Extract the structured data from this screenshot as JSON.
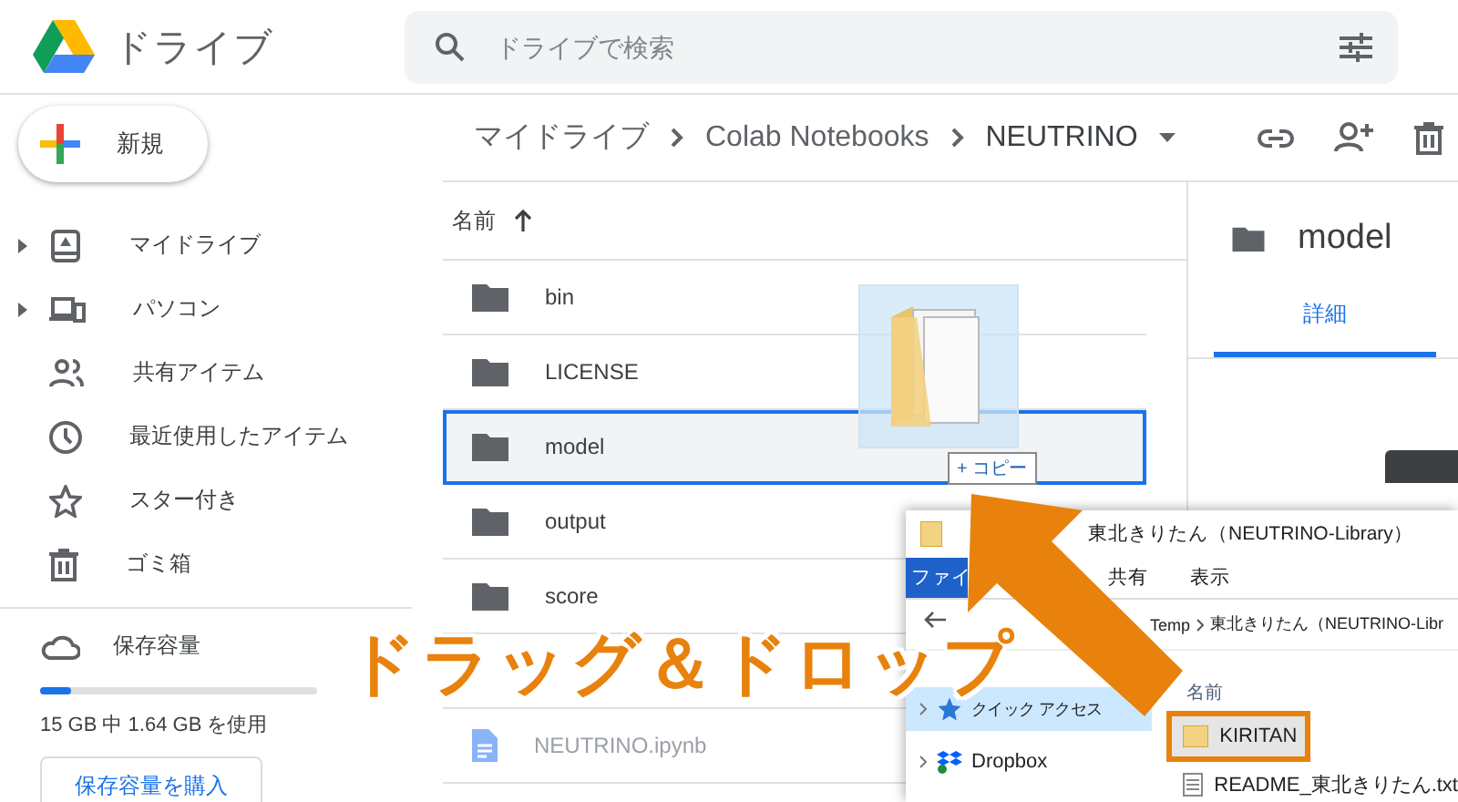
{
  "app": {
    "title": "ドライブ"
  },
  "search": {
    "placeholder": "ドライブで検索"
  },
  "new_button": {
    "label": "新規"
  },
  "sidebar": {
    "items": [
      {
        "label": "マイドライブ",
        "expandable": true
      },
      {
        "label": "パソコン",
        "expandable": true
      },
      {
        "label": "共有アイテム",
        "expandable": false
      },
      {
        "label": "最近使用したアイテム",
        "expandable": false
      },
      {
        "label": "スター付き",
        "expandable": false
      },
      {
        "label": "ゴミ箱",
        "expandable": false
      }
    ]
  },
  "storage": {
    "label": "保存容量",
    "level": 0.11,
    "usage": "15 GB 中 1.64 GB を使用",
    "button": "保存容量を購入"
  },
  "breadcrumb": [
    {
      "label": "マイドライブ"
    },
    {
      "label": "Colab Notebooks"
    },
    {
      "label": "NEUTRINO"
    }
  ],
  "file_list": {
    "sort_column": "名前",
    "rows": [
      {
        "name": "bin",
        "kind": "folder",
        "selected": false
      },
      {
        "name": "LICENSE",
        "kind": "folder",
        "selected": false
      },
      {
        "name": "model",
        "kind": "folder",
        "selected": true
      },
      {
        "name": "output",
        "kind": "folder",
        "selected": false
      },
      {
        "name": "score",
        "kind": "folder",
        "selected": false
      },
      {
        "name": "NEUTRINO.ipynb",
        "kind": "notebook",
        "selected": false
      }
    ]
  },
  "details": {
    "title": "model",
    "tabs": [
      {
        "label": "詳細",
        "selected": true
      }
    ]
  },
  "drag_ghost": {
    "badge": "+ コピー"
  },
  "explorer": {
    "title": "東北きりたん（NEUTRINO-Library）",
    "ribbon_tabs": [
      {
        "label": "ファイ",
        "selected": true
      },
      {
        "label": "共有",
        "selected": false
      },
      {
        "label": "表示",
        "selected": false
      }
    ],
    "address": [
      "Temp",
      "東北きりたん（NEUTRINO-Libr"
    ],
    "nav": [
      {
        "label": "クイック アクセス",
        "selected": true
      },
      {
        "label": "Dropbox",
        "selected": false
      }
    ],
    "column": "名前",
    "files": [
      {
        "name": "KIRITAN",
        "kind": "folder",
        "highlighted": true
      },
      {
        "name": "README_東北きりたん.txt",
        "kind": "text",
        "highlighted": false
      }
    ]
  },
  "annotation": {
    "caption": "ドラッグ＆ドロップ"
  }
}
